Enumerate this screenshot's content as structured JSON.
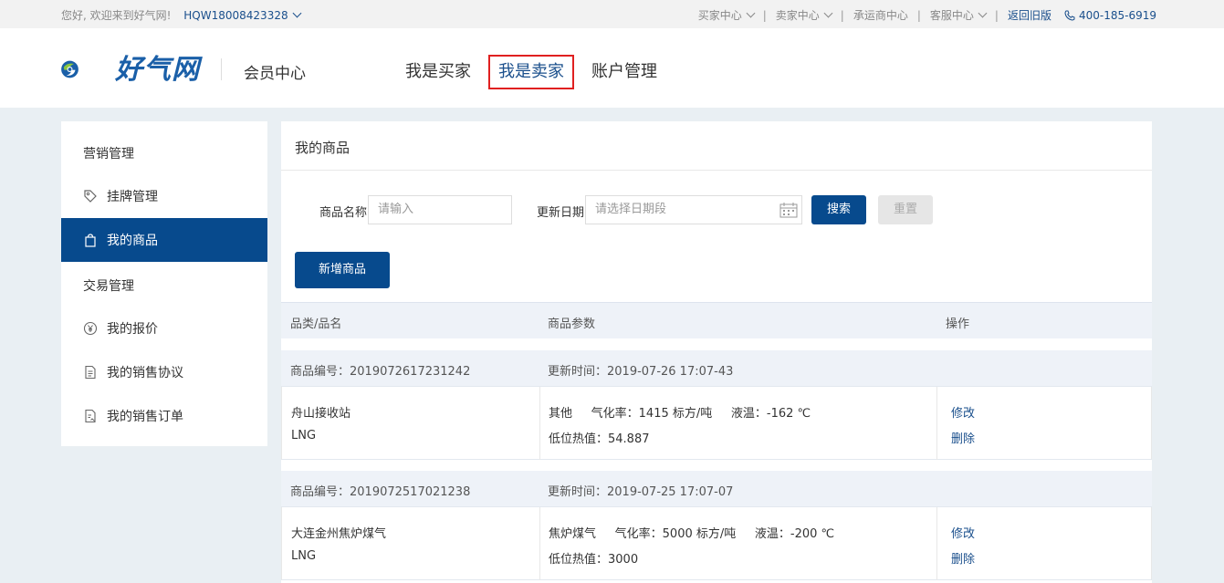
{
  "topbar": {
    "greeting": "您好, 欢迎来到好气网!",
    "username": "HQW18008423328",
    "links": [
      "买家中心",
      "卖家中心",
      "承运商中心",
      "客服中心"
    ],
    "old_version": "返回旧版",
    "phone": "400-185-6919"
  },
  "header": {
    "logo_text": "好气网",
    "member_center": "会员中心",
    "nav": [
      "我是买家",
      "我是卖家",
      "账户管理"
    ]
  },
  "sidebar": {
    "marketing_title": "营销管理",
    "listing": "挂牌管理",
    "my_products": "我的商品",
    "trade_title": "交易管理",
    "my_quotes": "我的报价",
    "my_sales_agreements": "我的销售协议",
    "my_sales_orders": "我的销售订单"
  },
  "main": {
    "title": "我的商品",
    "filters": {
      "name_label": "商品名称",
      "name_placeholder": "请输入",
      "date_label": "更新日期",
      "date_placeholder": "请选择日期段",
      "search": "搜索",
      "reset": "重置"
    },
    "add_button": "新增商品",
    "table_headers": [
      "品类/品名",
      "商品参数",
      "操作"
    ],
    "rows": [
      {
        "code": "商品编号：2019072617231242",
        "updated": "更新时间：2019-07-26 17:07-43",
        "name": "舟山接收站",
        "category": "LNG",
        "params1": "其他     气化率：1415 标方/吨     液温：-162 ℃",
        "params2": "低位热值：54.887",
        "edit": "修改",
        "delete": "删除"
      },
      {
        "code": "商品编号：2019072517021238",
        "updated": "更新时间：2019-07-25 17:07-07",
        "name": "大连金州焦炉煤气",
        "category": "LNG",
        "params1": "焦炉煤气     气化率：5000 标方/吨     液温：-200 ℃",
        "params2": "低位热值：3000",
        "edit": "修改",
        "delete": "删除"
      }
    ]
  }
}
